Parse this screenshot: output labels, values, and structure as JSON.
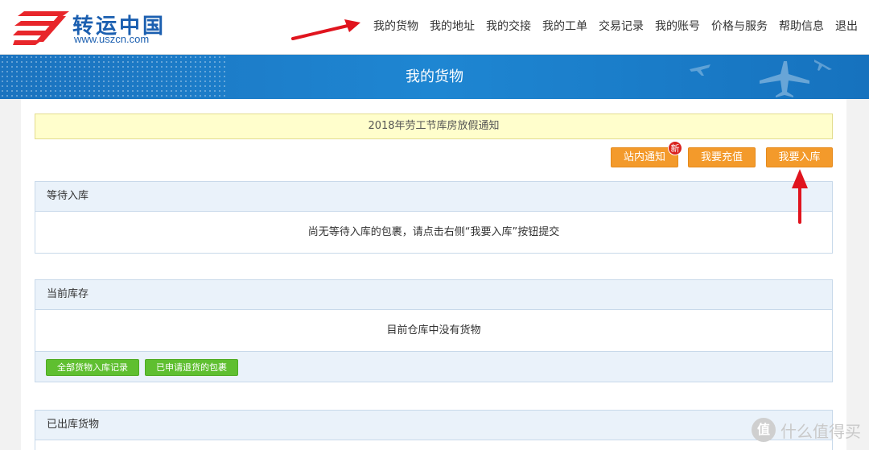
{
  "header": {
    "logo_name": "转运中国",
    "logo_url": "www.uszcn.com",
    "nav": [
      "我的货物",
      "我的地址",
      "我的交接",
      "我的工单",
      "交易记录",
      "我的账号",
      "价格与服务",
      "帮助信息",
      "退出"
    ]
  },
  "banner": {
    "title": "我的货物"
  },
  "notice": {
    "text": "2018年劳工节库房放假通知"
  },
  "actions": {
    "inbox": "站内通知",
    "inbox_badge": "新",
    "recharge": "我要充值",
    "stock_in": "我要入库"
  },
  "panels": {
    "pending": {
      "title": "等待入库",
      "message": "尚无等待入库的包裹，请点击右侧“我要入库”按钮提交"
    },
    "inventory": {
      "title": "当前库存",
      "message": "目前仓库中没有货物",
      "buttons": [
        "全部货物入库记录",
        "已申请退货的包裹"
      ]
    },
    "shipped": {
      "title": "已出库货物"
    }
  },
  "watermark": {
    "text": "什么值得买"
  },
  "colors": {
    "primary_blue": "#1b73bf",
    "orange": "#f39a2b",
    "green": "#5fbf30",
    "arrow_red": "#e0141e"
  }
}
